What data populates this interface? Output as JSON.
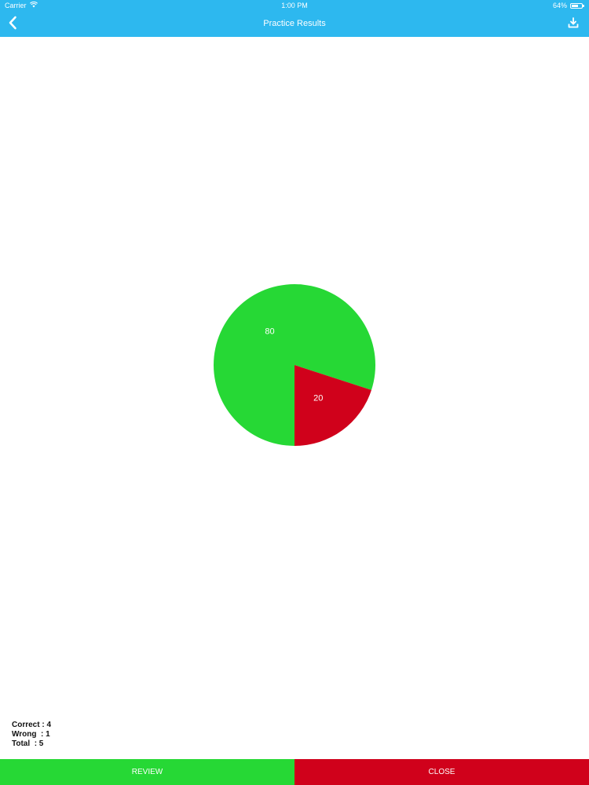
{
  "status_bar": {
    "carrier": "Carrier",
    "time": "1:00 PM",
    "battery_text": "64%",
    "battery_level": 0.64
  },
  "nav": {
    "title": "Practice Results",
    "back_icon": "chevron-left-icon",
    "download_icon": "download-icon"
  },
  "colors": {
    "nav_bg": "#2db8ef",
    "correct": "#26d835",
    "wrong": "#d0011b"
  },
  "chart_data": {
    "type": "pie",
    "slices": [
      {
        "label": "80",
        "value": 80,
        "color": "#26d835"
      },
      {
        "label": "20",
        "value": 20,
        "color": "#d0011b"
      }
    ]
  },
  "stats": {
    "correct": "Correct : 4",
    "wrong": "Wrong  : 1",
    "total": "Total  : 5"
  },
  "buttons": {
    "review": "REVIEW",
    "close": "CLOSE"
  }
}
